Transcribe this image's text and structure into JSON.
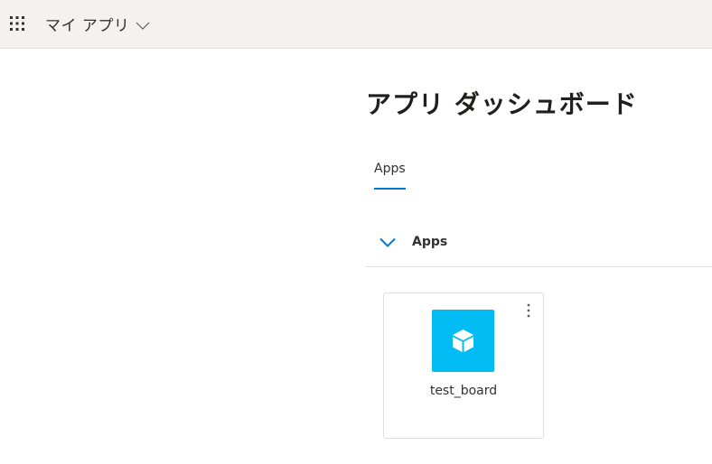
{
  "header": {
    "app_launcher_icon": "waffle-grid-icon",
    "title": "マイ アプリ",
    "title_chevron_icon": "chevron-down-icon",
    "background": "#f3f2f1"
  },
  "main": {
    "title": "アプリ ダッシュボード",
    "tabs": [
      {
        "label": "Apps",
        "selected": true
      }
    ],
    "accent_color": "#0078d4",
    "sections": [
      {
        "label": "Apps",
        "expanded": true,
        "chevron_icon": "chevron-down-icon",
        "apps": [
          {
            "name": "test_board",
            "icon": "cube-icon",
            "icon_color": "#00bcf2",
            "more_icon": "more-vertical-icon"
          }
        ]
      }
    ]
  }
}
